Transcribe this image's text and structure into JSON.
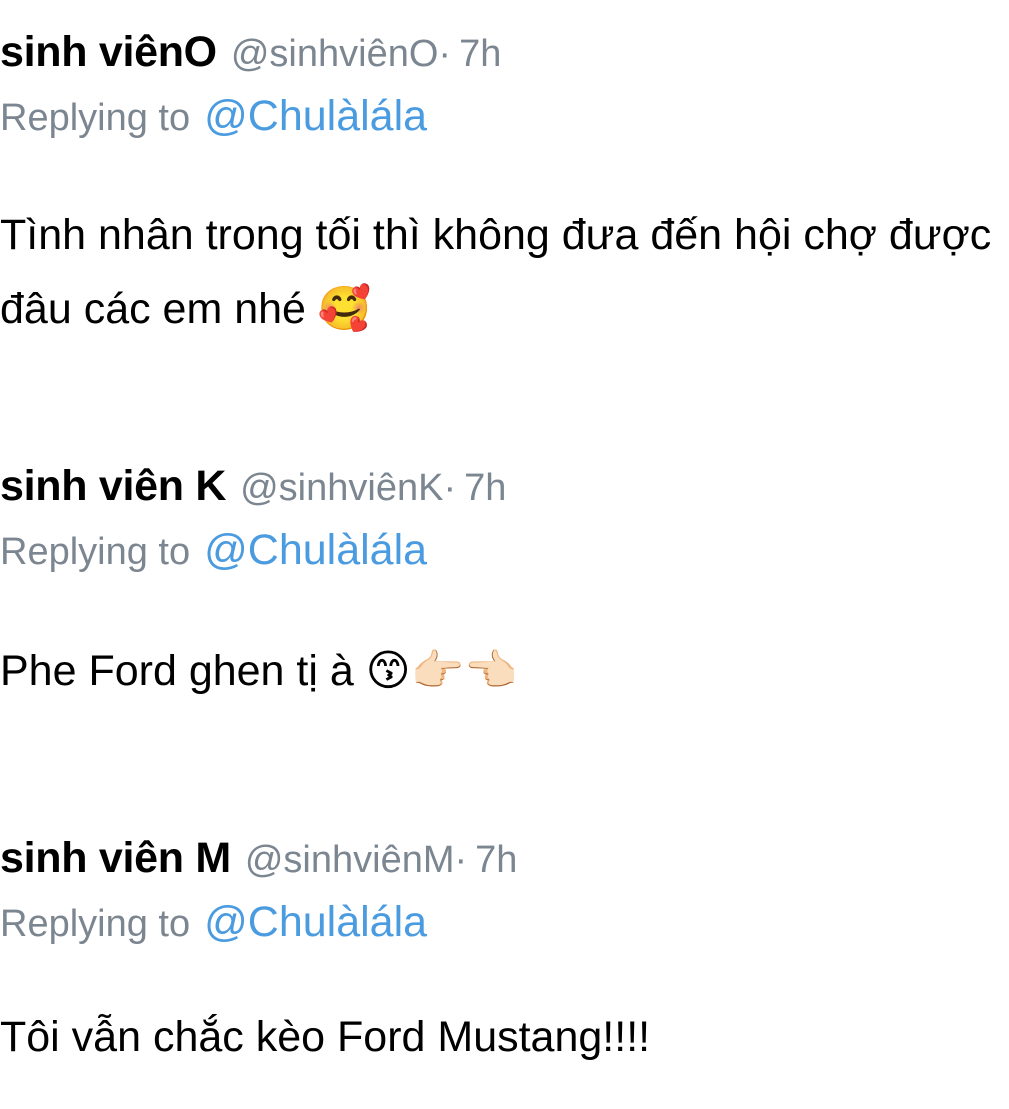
{
  "replies": [
    {
      "display_name": "sinh viênO",
      "handle": "@sinhviênO",
      "separator": "·",
      "time": "7h",
      "replying_label": "Replying to",
      "replying_to": "@Chulàlála",
      "text": "Tình nhân trong tối thì không đưa đến hội chợ được đâu các em nhé 🥰"
    },
    {
      "display_name": "sinh viên K",
      "handle": "@sinhviênK",
      "separator": "·",
      "time": "7h",
      "replying_label": "Replying to",
      "replying_to": "@Chulàlála",
      "text": "Phe Ford ghen tị à 😙👉🏻👈🏻"
    },
    {
      "display_name": "sinh viên M",
      "handle": "@sinhviênM",
      "separator": "·",
      "time": "7h",
      "replying_label": "Replying to",
      "replying_to": "@Chulàlála",
      "text": "Tôi vẫn chắc kèo Ford Mustang!!!!"
    }
  ],
  "colors": {
    "secondary_text": "#7b8690",
    "link": "#4a9be0",
    "primary_text": "#000000"
  }
}
